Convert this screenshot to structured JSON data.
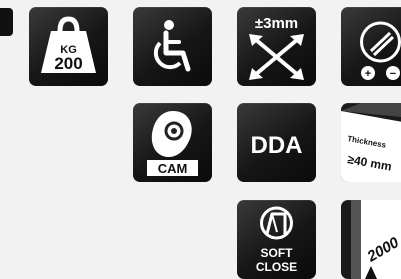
{
  "icons": {
    "load": {
      "unit": "KG",
      "value": "200"
    },
    "accessible": {},
    "adjust": {
      "label": "±3mm"
    },
    "closer": {
      "plus": "+",
      "minus": "−"
    },
    "cam": {
      "label": "CAM"
    },
    "dda": {
      "label": "DDA"
    },
    "thickness": {
      "label": "Thickness",
      "value": "≥40 mm"
    },
    "soft_close": {
      "line1": "SOFT",
      "line2": "CLOSE"
    },
    "height": {
      "value": "2000"
    }
  }
}
